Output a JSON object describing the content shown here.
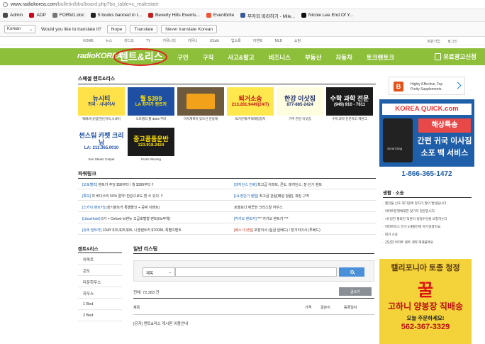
{
  "browser": {
    "url_host": "www.radiokorea.com",
    "url_path": "/bulletin/bbs/board.php?bo_table=c_realestate"
  },
  "bookmarks": [
    {
      "label": "Admin",
      "color": "#4a4a4a"
    },
    {
      "label": "ADP",
      "color": "#d0021b"
    },
    {
      "label": "FORM1.doc",
      "color": "#777777"
    },
    {
      "label": "5 books banned in t...",
      "color": "#222222"
    },
    {
      "label": "Beverly Hills Events...",
      "color": "#c21f1f"
    },
    {
      "label": "Eventbrite",
      "color": "#f05537"
    },
    {
      "label": "부자되 따라하기 - Mile...",
      "color": "#3b5998"
    },
    {
      "label": "Nicole Lee End Of Y...",
      "color": "#111111"
    }
  ],
  "translate": {
    "language": "Korean",
    "question": "Would you like to translate it?",
    "buttons": [
      "Nope",
      "Translate",
      "Never translate Korean"
    ]
  },
  "topnav": {
    "left": [
      "HOME",
      "뉴스",
      "라디오",
      "TV",
      "커뮤니티",
      "커뮤니",
      "USalk",
      "업소록",
      "이벤트",
      "MLB",
      "쇼핑"
    ],
    "right": [
      "회원가입",
      "로그인"
    ]
  },
  "header": {
    "logo": "radioKOREA",
    "section": "렌트&리스",
    "nav": [
      "구인",
      "구직",
      "사고&팔고",
      "비즈니스",
      "부동산",
      "자동차",
      "토크랜토크"
    ],
    "ad_button": "유료광고신청"
  },
  "special": {
    "title": "스페셜 렌트&리스",
    "tiles": [
      {
        "line1": "뉴시티",
        "line2": "귀국 · 시내이사",
        "caption": "택배/이삿짐전문(귀국,시내이",
        "bg": "#ffe14a",
        "color": "#1c3c8a"
      },
      {
        "line1": "월 $399",
        "line2": "LA 최저가 렌트카",
        "caption": "오토밸리 월 $399 부터",
        "bg": "#1e4fa3",
        "color": "#ffe000"
      },
      {
        "line1": "",
        "line2": "",
        "caption": "미서계획이 있으신 분들께",
        "bg": "#6e5a3c",
        "color": "#ffffff"
      },
      {
        "line1": "퇴거소송",
        "line2": "213.281.9449(24/7)",
        "caption": "퇴거문제/주택재정증지",
        "bg": "#ffe84d",
        "color": "#c0121b"
      },
      {
        "line1": "한강 이삿짐",
        "line2": "877-885-2424",
        "caption": "가주 한강 이삿짐",
        "bg": "#fffde0",
        "color": "#1c2c6b"
      },
      {
        "line1": "수학 과학 전문",
        "line2": "(949) 910 - 7611",
        "caption": "수학,과학 전문지도-캐반그",
        "bg": "#1b1b1b",
        "color": "#ffffff"
      },
      {
        "line1": "썬스팀 카펫 크리닝",
        "line2": "LA: 213.365.0010",
        "caption": "Sun Steam Carpet",
        "bg": "#ffffff",
        "color": "#1e4fa3"
      },
      {
        "line1": "중고품품운반",
        "line2": "323.918.2424",
        "caption": "HULK Moving",
        "bg": "#1b1b1b",
        "color": "#ffe000"
      }
    ]
  },
  "power": {
    "title": "파워링크",
    "rows": [
      [
        {
          "tag": "[오토밸리]",
          "text": " 렌트카 주당 $98부터 / 월 $399부터 !!",
          "red": false
        },
        {
          "tag": "[레지던스 인베]",
          "text": " 최고급 아파트, 콘도, 레지던스, 장·단기 렌트",
          "red": false
        }
      ],
      [
        {
          "tag": "[특보]",
          "text": " 차 바다수리 50% 절약! 반값으로도 할 수 있다. !!",
          "red": false
        },
        {
          "tag": "[LA 장단기 렌탈]",
          "text": " 최고급 관람(폐설 월렴), 파킹 구역",
          "red": false
        }
      ],
      [
        {
          "tag": "[스카이 렌트카]",
          "text": " (장기렌트카 특별할인 + 공짜 이벤트)",
          "red": false
        },
        {
          "tag": "",
          "text": "호텔보다 깨끗한 크리스탈 하우스",
          "red": false
        }
      ],
      [
        {
          "tag": "[LibraHotel]",
          "text": " 6가 + Oxford-브랜뉴 고급호텔형 렌트(No부엌)",
          "red": false
        },
        {
          "tag": "[카카오 렌트카]",
          "text": " *** 카카오 렌트카 ***",
          "red": false
        }
      ],
      [
        {
          "tag": "[슈퍼 렌트카]",
          "text": " 1DAY $15,$25,$35, 니센렌트카 $700/M, 특별이벤트",
          "red": false
        },
        {
          "tag": "[베스 이삿짐]",
          "text": " 포장이사 (실금 원베드) / 장거리이사 (투베드)",
          "red": true
        }
      ]
    ]
  },
  "left_menu": {
    "title": "렌트&리스",
    "items": [
      "아파트",
      "콘도",
      "타운하우스",
      "하우스",
      "1 Bed",
      "2 Bed"
    ]
  },
  "listing": {
    "title": "일반 리스팅",
    "search_select": "제목",
    "total": "전체: 72,283 건",
    "write": "글쓰기",
    "columns": [
      "제목",
      "가격",
      "글쓴이",
      "등록일자"
    ],
    "rows": [
      "[공지] 렌트&리스 게시판 이용안내"
    ]
  },
  "right": {
    "ad1_line1": "Highly Effective, Top",
    "ad1_line2": "Purity Supplements.",
    "ad2_brand": "KOREA",
    "ad2_domain": "QUICK.com",
    "ad2_bag": "Smart Bag",
    "ad2_headline": "해상특송",
    "ad2_line2": "간편 귀국 이사짐",
    "ad2_line3": "소포 백 서비스",
    "ad2_phone": "1-866-365-1472",
    "news_title": "생활 · 소송",
    "news": [
      "별건물 신호 대기중에 정차가 많이 발생습니다.",
      "아파트분쟁에대한 젖기지 질문입니다.",
      "7유일만 월되던 직원이 실업수당을 요청하는다",
      "아파트리스 전기 6개월간에 하기생겼어요.",
      "퇴거 소송",
      "간단한 아파트 렌트 계약 해해볼께요"
    ],
    "ad3_line1": "캘리포니아 토종 청정",
    "ad3_line2": "꿀",
    "ad3_line3": "고하니 양봉장 직배송",
    "ad3_line4": "오늘 주문하세요!",
    "ad3_line5": "562-367-3329"
  }
}
